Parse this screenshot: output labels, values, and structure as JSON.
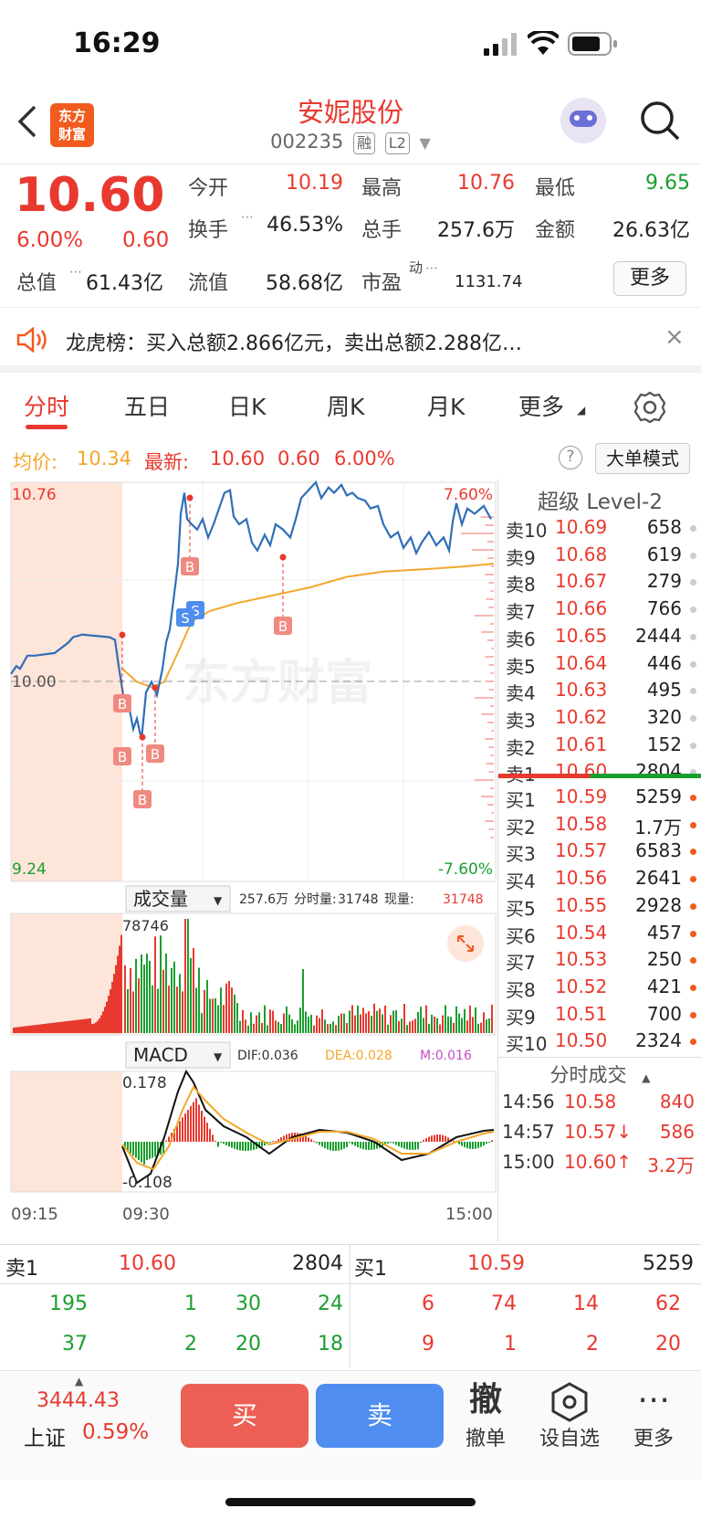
{
  "status": {
    "time": "16:29"
  },
  "header": {
    "logo_text_1": "东方",
    "logo_text_2": "财富",
    "title": "安妮股份",
    "code": "002235",
    "tag_margin": "融",
    "tag_level": "L2"
  },
  "quote": {
    "price": "10.60",
    "change_pct": "6.00%",
    "change": "0.60",
    "open_label": "今开",
    "open": "10.19",
    "high_label": "最高",
    "high": "10.76",
    "low_label": "最低",
    "low": "9.65",
    "turnover_label": "换手",
    "turnover": "46.53%",
    "volume_label": "总手",
    "volume": "257.6万",
    "amount_label": "金额",
    "amount": "26.63亿",
    "mktcap_label": "总值",
    "mktcap": "61.43亿",
    "float_label": "流值",
    "float": "58.68亿",
    "pe_label": "市盈",
    "pe_sup": "动",
    "pe": "1131.74",
    "more": "更多"
  },
  "banner": {
    "text": "龙虎榜：买入总额2.866亿元，卖出总额2.288亿…"
  },
  "tabs": [
    "分时",
    "五日",
    "日K",
    "周K",
    "月K",
    "更多"
  ],
  "avg": {
    "avg_label": "均价:",
    "avg_value": "10.34",
    "last_label": "最新:",
    "last_value": "10.60",
    "last_change": "0.60",
    "last_pct": "6.00%",
    "mode_button": "大单模式"
  },
  "chart": {
    "y_top": "10.76",
    "y_mid": "10.00",
    "y_bottom": "9.24",
    "pct_top": "7.60%",
    "pct_bottom": "-7.60%",
    "watermark": "东方财富",
    "vol_selector": "成交量",
    "vol_info_total": "257.6万",
    "vol_info_period_label": "分时量:",
    "vol_info_period": "31748",
    "vol_info_now_label": "现量:",
    "vol_info_now": "31748",
    "vol_max": "78746",
    "macd_selector": "MACD",
    "dif": "DIF:0.036",
    "dea": "DEA:0.028",
    "m": "M:0.016",
    "macd_top": "0.178",
    "macd_bottom": "-0.108",
    "t_start": "09:15",
    "t_open": "09:30",
    "t_end": "15:00",
    "marker_b": "B",
    "marker_s": "S",
    "colors": {
      "price_line": "#2f6fb8",
      "avg_line": "#f2a72c",
      "up": "#e8392f",
      "down": "#1a9f2f"
    }
  },
  "orderbook": {
    "title": "超级 Level-2",
    "asks": [
      {
        "label": "卖10",
        "price": "10.69",
        "vol": "658"
      },
      {
        "label": "卖9",
        "price": "10.68",
        "vol": "619"
      },
      {
        "label": "卖8",
        "price": "10.67",
        "vol": "279"
      },
      {
        "label": "卖7",
        "price": "10.66",
        "vol": "766"
      },
      {
        "label": "卖6",
        "price": "10.65",
        "vol": "2444"
      },
      {
        "label": "卖5",
        "price": "10.64",
        "vol": "446"
      },
      {
        "label": "卖4",
        "price": "10.63",
        "vol": "495"
      },
      {
        "label": "卖3",
        "price": "10.62",
        "vol": "320"
      },
      {
        "label": "卖2",
        "price": "10.61",
        "vol": "152"
      },
      {
        "label": "卖1",
        "price": "10.60",
        "vol": "2804"
      }
    ],
    "bids": [
      {
        "label": "买1",
        "price": "10.59",
        "vol": "5259"
      },
      {
        "label": "买2",
        "price": "10.58",
        "vol": "1.7万"
      },
      {
        "label": "买3",
        "price": "10.57",
        "vol": "6583"
      },
      {
        "label": "买4",
        "price": "10.56",
        "vol": "2641"
      },
      {
        "label": "买5",
        "price": "10.55",
        "vol": "2928"
      },
      {
        "label": "买6",
        "price": "10.54",
        "vol": "457"
      },
      {
        "label": "买7",
        "price": "10.53",
        "vol": "250"
      },
      {
        "label": "买8",
        "price": "10.52",
        "vol": "421"
      },
      {
        "label": "买9",
        "price": "10.51",
        "vol": "700"
      },
      {
        "label": "买10",
        "price": "10.50",
        "vol": "2324"
      }
    ],
    "ticks_title": "分时成交",
    "ticks": [
      {
        "time": "14:56",
        "price": "10.58",
        "vol": "840"
      },
      {
        "time": "14:57",
        "price": "10.57↓",
        "vol": "586"
      },
      {
        "time": "15:00",
        "price": "10.60↑",
        "vol": "3.2万"
      }
    ]
  },
  "queue": {
    "sell_label": "卖1",
    "sell_price": "10.60",
    "sell_total": "2804",
    "buy_label": "买1",
    "buy_price": "10.59",
    "buy_total": "5259",
    "sell_row1": [
      "195",
      "1",
      "30",
      "24"
    ],
    "sell_row2": [
      "37",
      "2",
      "20",
      "18"
    ],
    "buy_row1": [
      "6",
      "74",
      "14",
      "62"
    ],
    "buy_row2": [
      "9",
      "1",
      "2",
      "20"
    ]
  },
  "toolbar": {
    "index_value": "3444.43",
    "index_name": "上证",
    "index_pct": "0.59%",
    "buy": "买",
    "sell": "卖",
    "cancel_icon": "撤",
    "cancel": "撤单",
    "watch": "设自选",
    "more": "更多"
  }
}
